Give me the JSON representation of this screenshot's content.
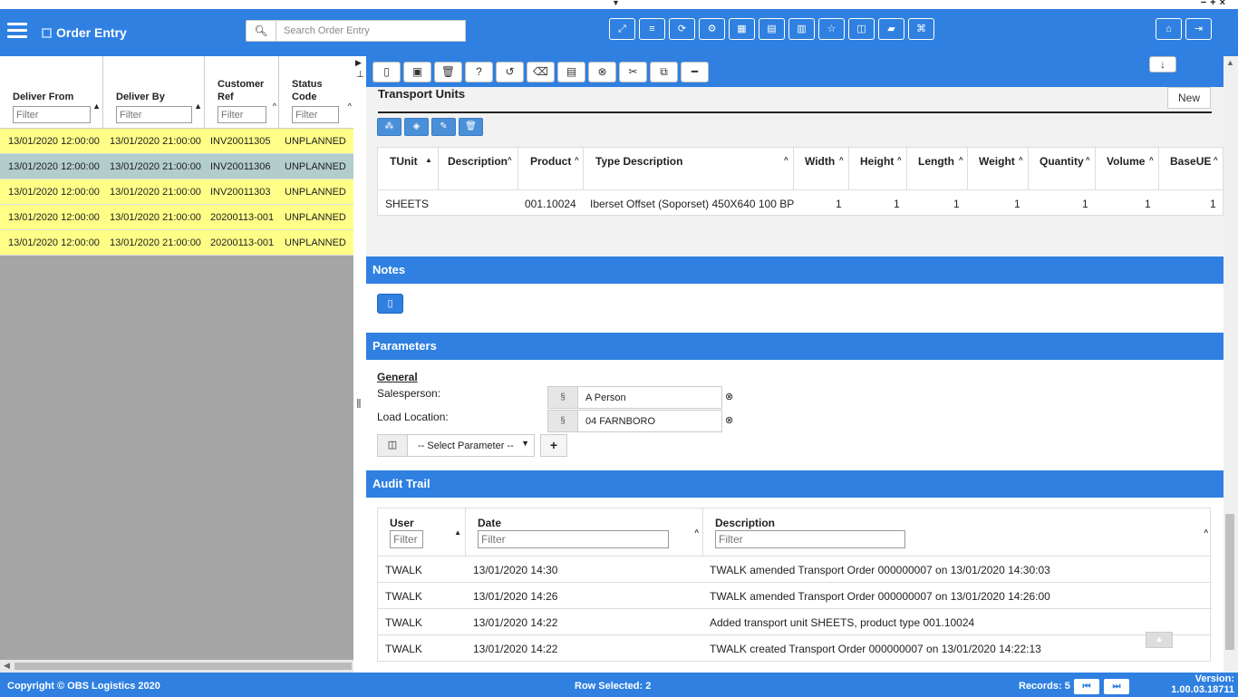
{
  "app": {
    "title": "Order Entry"
  },
  "search": {
    "placeholder": "Search Order Entry"
  },
  "toolbar_icons": [
    "expand-icon",
    "database-icon",
    "refresh-icon",
    "cogs-icon",
    "grid-icon",
    "export-icon",
    "pdf-icon",
    "star-icon",
    "columns-icon",
    "book-icon",
    "sitemap-icon"
  ],
  "grid": {
    "columns": [
      {
        "label": "Deliver From",
        "filter": "Filter"
      },
      {
        "label": "Deliver By",
        "filter": "Filter"
      },
      {
        "label": "Customer Ref",
        "filter": "Filter"
      },
      {
        "label": "Status Code",
        "filter": "Filter"
      }
    ],
    "rows": [
      {
        "from": "13/01/2020 12:00:00",
        "by": "13/01/2020 21:00:00",
        "ref": "INV20011305",
        "status": "UNPLANNED",
        "selected": false
      },
      {
        "from": "13/01/2020 12:00:00",
        "by": "13/01/2020 21:00:00",
        "ref": "INV20011306",
        "status": "UNPLANNED",
        "selected": true
      },
      {
        "from": "13/01/2020 12:00:00",
        "by": "13/01/2020 21:00:00",
        "ref": "INV20011303",
        "status": "UNPLANNED",
        "selected": false
      },
      {
        "from": "13/01/2020 12:00:00",
        "by": "13/01/2020 21:00:00",
        "ref": "20200113-001",
        "status": "UNPLANNED",
        "selected": false
      },
      {
        "from": "13/01/2020 12:00:00",
        "by": "13/01/2020 21:00:00",
        "ref": "20200113-001",
        "status": "UNPLANNED",
        "selected": false
      }
    ]
  },
  "transport_units": {
    "title": "Transport Units",
    "new_label": "New",
    "columns": [
      "TUnit",
      "Description",
      "Product",
      "Type Description",
      "Width",
      "Height",
      "Length",
      "Weight",
      "Quantity",
      "Volume",
      "BaseUE"
    ],
    "rows": [
      {
        "tunit": "SHEETS",
        "description": "",
        "product": "001.10024",
        "type_description": "Iberset Offset (Soporset) 450X640 100 BP",
        "width": "1",
        "height": "1",
        "length": "1",
        "weight": "1",
        "quantity": "1",
        "volume": "1",
        "baseue": "1"
      }
    ]
  },
  "notes": {
    "title": "Notes"
  },
  "parameters": {
    "title": "Parameters",
    "group": "General",
    "items": [
      {
        "label": "Salesperson:",
        "value": "A Person"
      },
      {
        "label": "Load Location:",
        "value": "04 FARNBORO"
      }
    ],
    "select_placeholder": "-- Select Parameter --"
  },
  "audit": {
    "title": "Audit Trail",
    "columns": [
      {
        "label": "User",
        "filter": "Filter"
      },
      {
        "label": "Date",
        "filter": "Filter"
      },
      {
        "label": "Description",
        "filter": "Filter"
      }
    ],
    "rows": [
      {
        "user": "TWALK",
        "date": "13/01/2020 14:30",
        "description": "TWALK amended Transport Order 000000007 on 13/01/2020 14:30:03"
      },
      {
        "user": "TWALK",
        "date": "13/01/2020 14:26",
        "description": "TWALK amended Transport Order 000000007 on 13/01/2020 14:26:00"
      },
      {
        "user": "TWALK",
        "date": "13/01/2020 14:22",
        "description": "Added transport unit SHEETS, product type 001.10024"
      },
      {
        "user": "TWALK",
        "date": "13/01/2020 14:22",
        "description": "TWALK created Transport Order 000000007 on 13/01/2020 14:22:13"
      }
    ]
  },
  "footer": {
    "copyright": "Copyright © OBS Logistics 2020",
    "row_selected": "Row Selected: 2",
    "records": "Records: 5",
    "version_label": "Version:",
    "version": "1.00.03.18711"
  },
  "colors": {
    "brand": "#2f80e0",
    "row_yellow": "#ffff88",
    "row_selected": "#b3cccc"
  }
}
